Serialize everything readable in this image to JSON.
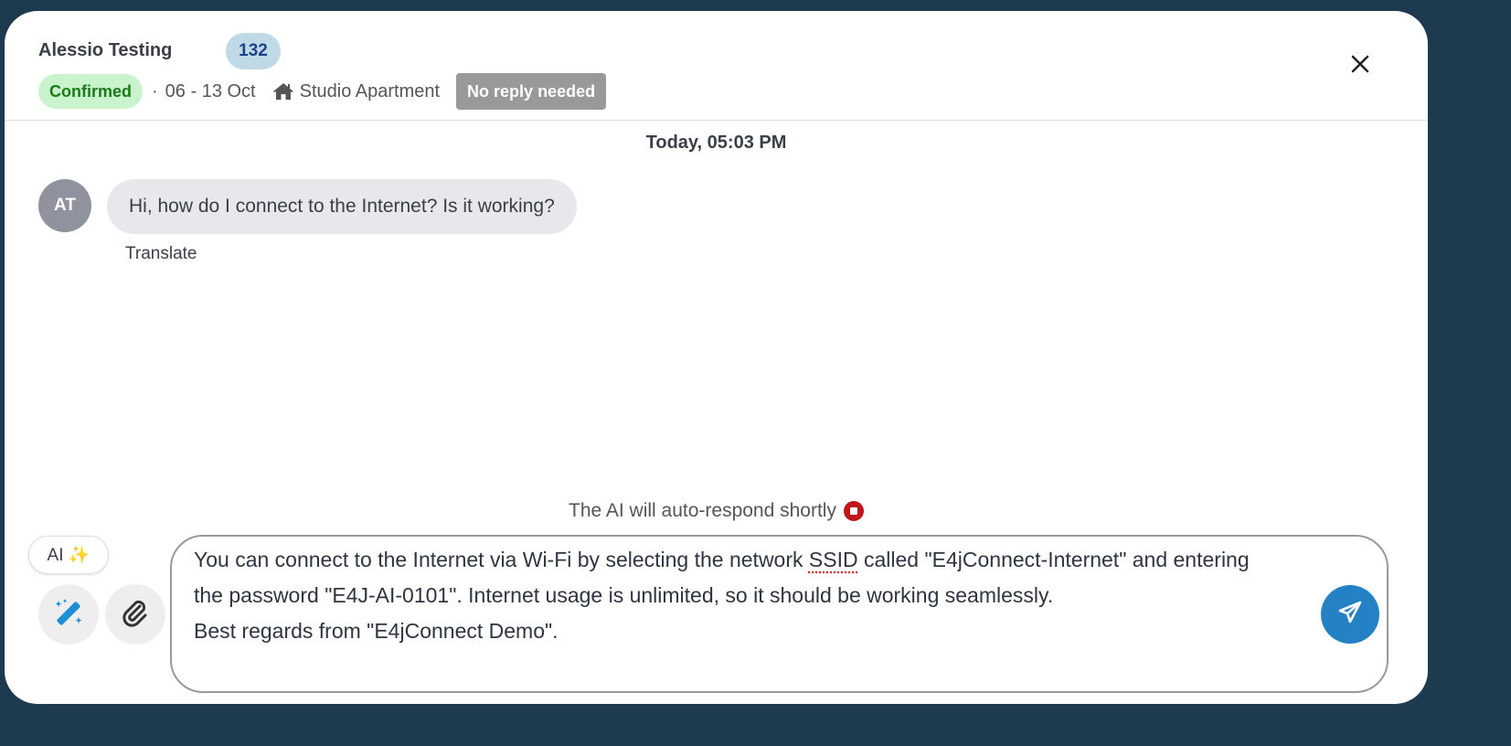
{
  "header": {
    "guest_name": "Alessio Testing",
    "count_badge": "132",
    "status": "Confirmed",
    "separator": "·",
    "dates": "06 - 13 Oct",
    "listing": "Studio Apartment",
    "tag": "No reply needed"
  },
  "chat": {
    "date_label": "Today, 05:03 PM",
    "messages": [
      {
        "avatar": "AT",
        "text": "Hi, how do I connect to the Internet? Is it working?",
        "translate": "Translate"
      }
    ]
  },
  "ai_notice": "The AI will auto-respond shortly",
  "composer": {
    "ai_button": "AI ✨",
    "draft_before": "You can connect to the Internet via Wi-Fi by selecting the network ",
    "draft_flagged": "SSID",
    "draft_after": " called \"E4jConnect-Internet\" and entering the password \"E4J-AI-0101\". Internet usage is unlimited, so it should be working seamlessly.\nBest regards from \"E4jConnect Demo\"."
  },
  "colors": {
    "accent": "#2481c4",
    "confirmed_bg": "#c9f3cc",
    "stop": "#c0161b"
  }
}
